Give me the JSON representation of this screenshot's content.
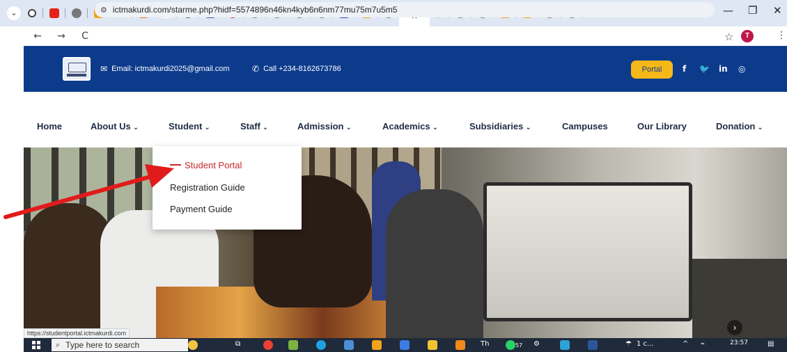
{
  "browser": {
    "tab_menu_icon": "chevron-down-icon",
    "tab_icons": [
      "record-icon",
      "youtube-icon",
      "globe-icon",
      "link-icon",
      "tiktok-icon",
      "flag-icon",
      "gmail-icon",
      "compass-icon",
      "doc-icon",
      "stop-icon",
      "globe-icon",
      "globe-icon",
      "globe-icon",
      "globe-icon",
      "sheet-icon",
      "slides-icon",
      "globe-icon"
    ],
    "active_tab_close": "×",
    "trailing_tab_icons": [
      "globe-icon",
      "globe-icon",
      "slides-icon",
      "slides-icon",
      "globe-icon",
      "globe-icon"
    ],
    "new_tab": "+",
    "window_controls": {
      "minimize": "—",
      "maximize": "❐",
      "close": "✕"
    },
    "nav": {
      "back": "←",
      "forward": "→",
      "reload": "C"
    },
    "url": "ictmakurdi.com/starme.php?hidf=5574896n46kn4kyb6n6nm77mu75m7u5m5",
    "profile_initial": "T",
    "status_url": "https://studentportal.ictmakurdi.com"
  },
  "header": {
    "email_text": "Email: ictmakurdi2025@gmail.com",
    "phone_text": "Call +234-8162673786",
    "portal_label": "Portal",
    "social": [
      "f",
      "❤",
      "in",
      "◎"
    ]
  },
  "nav": {
    "items": [
      {
        "label": "Home",
        "dropdown": false
      },
      {
        "label": "About Us",
        "dropdown": true
      },
      {
        "label": "Student",
        "dropdown": true
      },
      {
        "label": "Staff",
        "dropdown": true
      },
      {
        "label": "Admission",
        "dropdown": true
      },
      {
        "label": "Academics",
        "dropdown": true
      },
      {
        "label": "Subsidiaries",
        "dropdown": true
      },
      {
        "label": "Campuses",
        "dropdown": false
      },
      {
        "label": "Our Library",
        "dropdown": false
      },
      {
        "label": "Donation",
        "dropdown": true
      }
    ],
    "chevron": "⌄"
  },
  "student_dropdown": {
    "items": [
      "Student Portal",
      "Registration Guide",
      "Payment Guide"
    ],
    "active_index": 0
  },
  "taskbar": {
    "search_placeholder": "Type here to search",
    "weather": "1 c...",
    "time": "23:57",
    "badge": "57"
  },
  "colors": {
    "header_bg": "#0d3b8c",
    "portal_button": "#f6b819",
    "active_menu": "#c62828",
    "annotation_arrow": "#e11b1b"
  }
}
